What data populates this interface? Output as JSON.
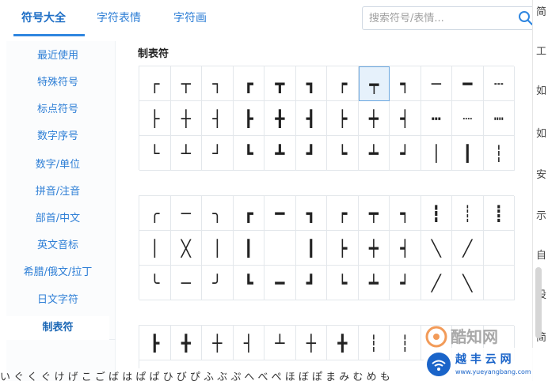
{
  "tabs": [
    {
      "label": "符号大全",
      "active": true
    },
    {
      "label": "字符表情",
      "active": false
    },
    {
      "label": "字符画",
      "active": false
    }
  ],
  "search": {
    "placeholder": "搜索符号/表情..."
  },
  "sidebar": {
    "items": [
      {
        "label": "最近使用"
      },
      {
        "label": "特殊符号"
      },
      {
        "label": "标点符号"
      },
      {
        "label": "数字序号"
      },
      {
        "label": "数字/单位"
      },
      {
        "label": "拼音/注音"
      },
      {
        "label": "部首/中文"
      },
      {
        "label": "英文音标"
      },
      {
        "label": "希腊/俄文/拉丁"
      },
      {
        "label": "日文字符"
      },
      {
        "label": "制表符",
        "active": true
      }
    ]
  },
  "main": {
    "title": "制表符",
    "block1": [
      [
        "┌",
        "┬",
        "┐",
        "┏",
        "┳",
        "┓",
        "┍",
        "┯",
        "┑",
        "─",
        "━",
        "┄"
      ],
      [
        "├",
        "┼",
        "┤",
        "┣",
        "╋",
        "┫",
        "┝",
        "┿",
        "┥",
        "┅",
        "┈",
        "┉"
      ],
      [
        "└",
        "┴",
        "┘",
        "┗",
        "┻",
        "┛",
        "┕",
        "┷",
        "┙",
        "│",
        "┃",
        "┆"
      ]
    ],
    "block2": [
      [
        "╭",
        "─",
        "╮",
        "┏",
        "━",
        "┓",
        "┍",
        "┯",
        "┑",
        "┇",
        "┊",
        "┋"
      ],
      [
        "│",
        "╳",
        "│",
        "┃",
        "",
        "┃",
        "┝",
        "┿",
        "┥",
        "╲",
        "╱",
        ""
      ],
      [
        "╰",
        "─",
        "╯",
        "┗",
        "━",
        "┛",
        "┕",
        "┷",
        "┙",
        "╱",
        "╲",
        ""
      ]
    ],
    "block3": [
      [
        "┣",
        "╋",
        "┼",
        "┤",
        "┴",
        "┼",
        "╋",
        "┆",
        "┆",
        "",
        "",
        ""
      ]
    ],
    "selected_cell": "block1.0.7"
  },
  "right_sliver": [
    "简",
    "工",
    "如",
    "如",
    "安",
    "示",
    "自",
    "设",
    "简"
  ],
  "watermarks": {
    "logo1": "酷知网",
    "logo2_title": "越 丰 云 网",
    "logo2_url": "www.yueyangbang.com"
  },
  "bottom_text": "い ぐ く ぐ け げ こ ご ば は ぱ ぱ ひ び ぴ ふ ぶ ぷ へ べ ぺ ほ ぼ ぽ ま み む め も"
}
